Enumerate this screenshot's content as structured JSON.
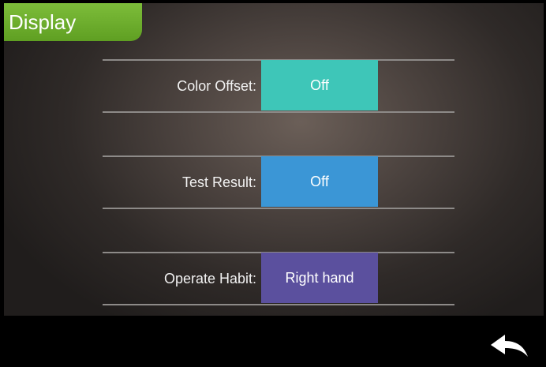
{
  "header": {
    "title": "Display"
  },
  "settings": [
    {
      "label": "Color Offset:",
      "value": "Off",
      "color": "#3ec6b8"
    },
    {
      "label": "Test Result:",
      "value": "Off",
      "color": "#3b96d6"
    },
    {
      "label": "Operate Habit:",
      "value": "Right hand",
      "color": "#5b509e"
    }
  ],
  "footer": {
    "back_icon": "back-arrow-icon"
  },
  "colors": {
    "title_tab": "#6fad2c",
    "background": "#000000"
  }
}
